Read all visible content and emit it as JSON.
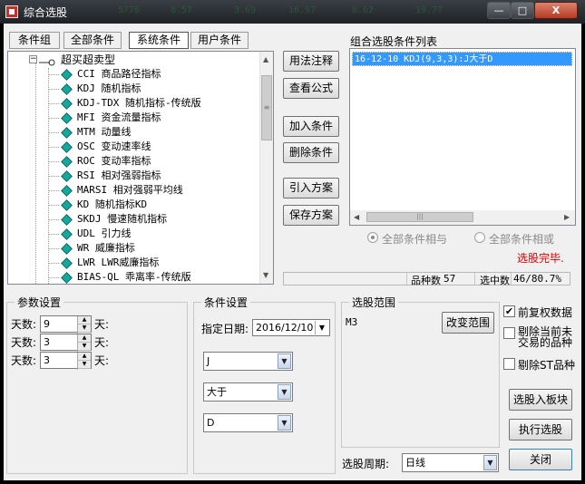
{
  "window": {
    "title": "综合选股",
    "background_tickers": [
      "5776",
      "8.57",
      "3.69",
      "16.97",
      "8.62",
      "19.77"
    ],
    "controls": {
      "minimize": "—",
      "maximize": "□",
      "close": "X"
    }
  },
  "tabs": [
    {
      "label": "条件组"
    },
    {
      "label": "全部条件"
    },
    {
      "label": "系统条件"
    },
    {
      "label": "用户条件"
    }
  ],
  "tree": {
    "group_label": "超买超卖型",
    "items": [
      "CCI 商品路径指标",
      "KDJ 随机指标",
      "KDJ-TDX 随机指标-传统版",
      "MFI 资金流量指标",
      "MTM 动量线",
      "OSC 变动速率线",
      "ROC 变动率指标",
      "RSI 相对强弱指标",
      "MARSI 相对强弱平均线",
      "KD 随机指标KD",
      "SKDJ 慢速随机指标",
      "UDL 引力线",
      "WR 威廉指标",
      "LWR LWR威廉指标",
      "BIAS-QL 乖离率-传统版"
    ]
  },
  "middle_buttons": {
    "usage": "用法注释",
    "formula": "查看公式",
    "add": "加入条件",
    "delete": "删除条件",
    "import": "引入方案",
    "save": "保存方案"
  },
  "condition_list": {
    "title": "组合选股条件列表",
    "items": [
      "16-12-10 KDJ(9,3,3):J大于D"
    ]
  },
  "logic": {
    "and_label": "全部条件相与",
    "or_label": "全部条件相或",
    "selected": "and"
  },
  "status": {
    "done_text": "选股完毕.",
    "done_color": "#e00000",
    "count_label": "品种数",
    "count_value": "57",
    "selected_label": "选中数",
    "selected_value": "46/80.7%"
  },
  "params": {
    "title": "参数设置",
    "rows": [
      {
        "prefix": "天数:",
        "value": "9",
        "suffix": "天:"
      },
      {
        "prefix": "天数:",
        "value": "3",
        "suffix": "天:"
      },
      {
        "prefix": "天数:",
        "value": "3",
        "suffix": "天:"
      }
    ]
  },
  "conditions": {
    "title": "条件设置",
    "date_label": "指定日期:",
    "date_value": "2016/12/10",
    "line1": "J",
    "operator": "大于",
    "line2": "D"
  },
  "range": {
    "title": "选股范围",
    "value": "M3",
    "change_button": "改变范围",
    "period_label": "选股周期:",
    "period_value": "日线"
  },
  "options": {
    "restore_rights": {
      "label": "前复权数据",
      "checked": true
    },
    "exclude_untraded": {
      "label_line1": "剔除当前未",
      "label_line2": "交易的品种",
      "checked": false
    },
    "exclude_st": {
      "label": "剔除ST品种",
      "checked": false
    }
  },
  "action_buttons": {
    "to_block": "选股入板块",
    "run": "执行选股",
    "close": "关闭"
  },
  "colors": {
    "selection": "#3399ff",
    "accent_green": "#1aa79b"
  }
}
